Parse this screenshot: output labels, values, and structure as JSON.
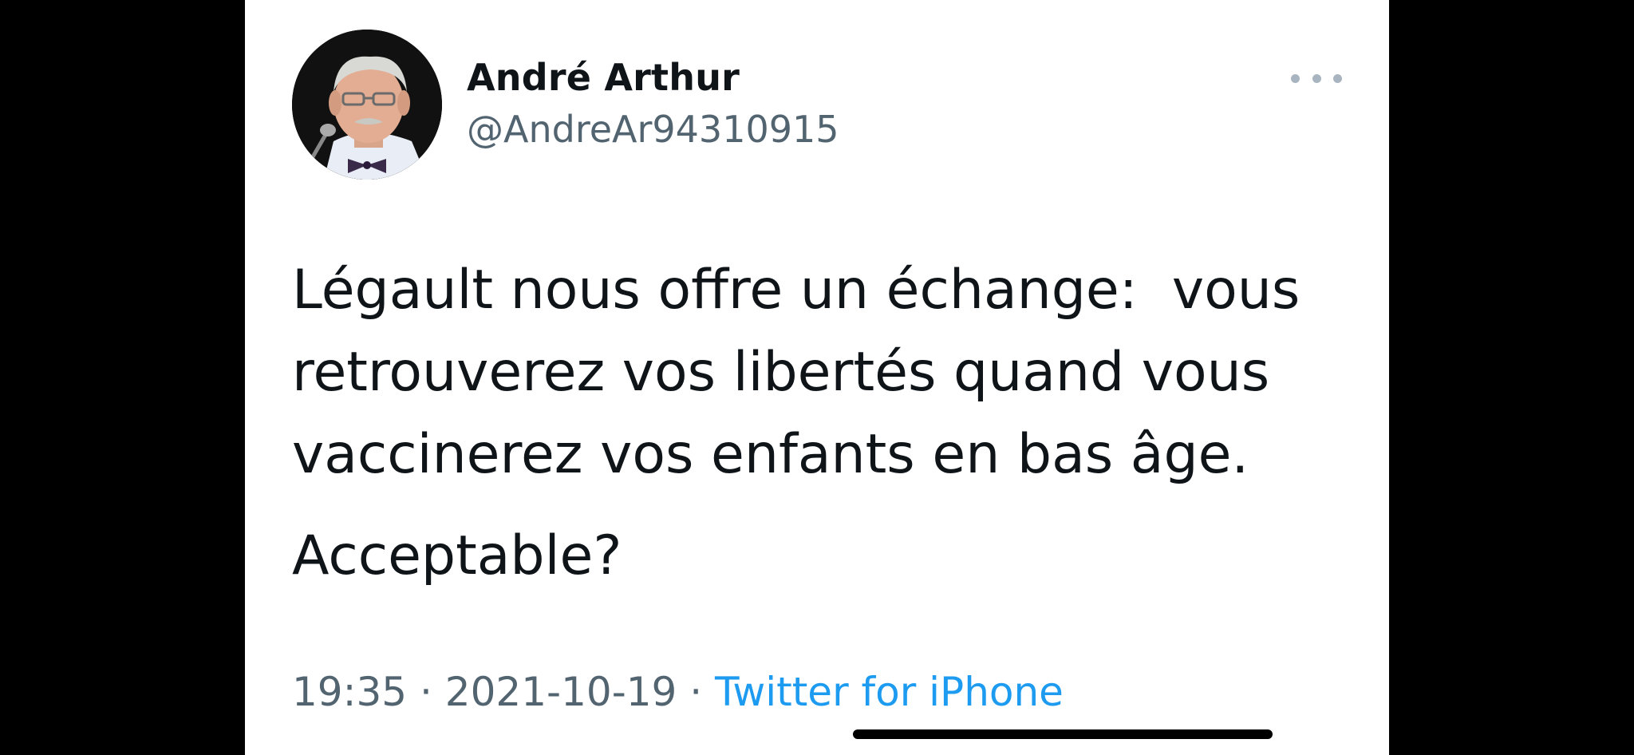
{
  "tweet": {
    "author": {
      "display_name": "André Arthur",
      "handle": "@AndreAr94310915"
    },
    "text_lines": [
      "Légault nous offre un échange:  vous",
      "retrouverez vos libertés quand vous",
      "vaccinerez vos enfants en bas âge."
    ],
    "text_second_paragraph": "Acceptable?",
    "meta": {
      "time": "19:35",
      "separator": " · ",
      "date": "2021-10-19",
      "source": "Twitter for iPhone"
    },
    "icons": {
      "more": "more-options-icon",
      "avatar": "profile-photo"
    }
  },
  "colors": {
    "text_primary": "#0f1419",
    "text_secondary": "#536471",
    "link": "#1d9bf0",
    "background": "#ffffff",
    "letterbox": "#000000"
  }
}
